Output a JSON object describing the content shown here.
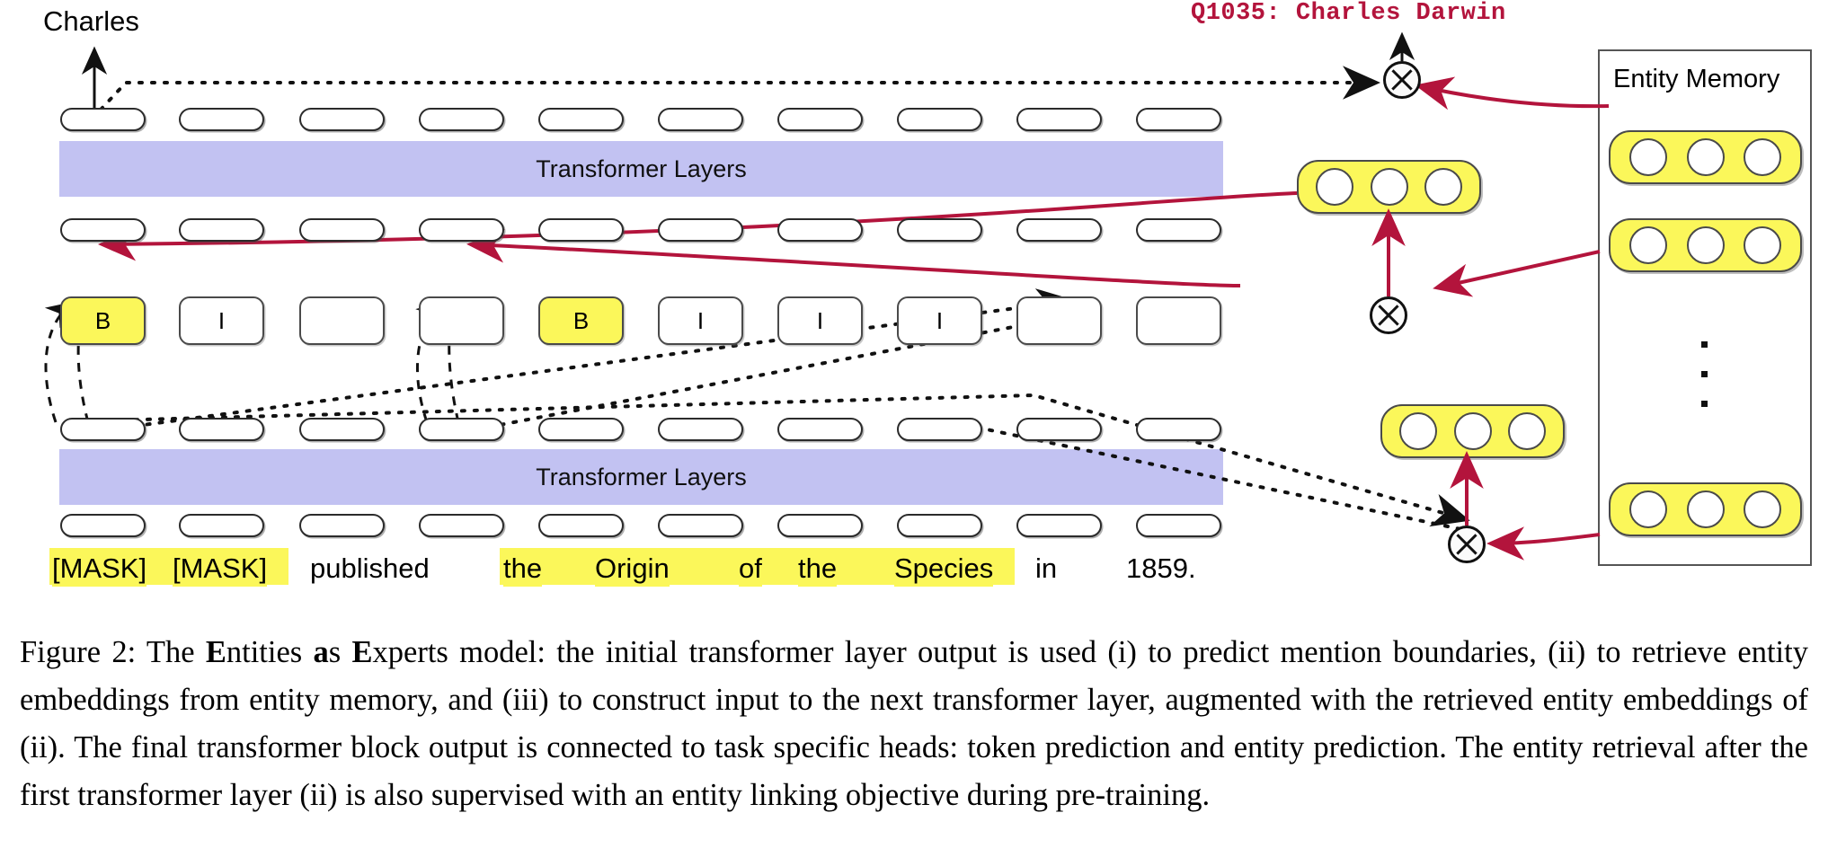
{
  "figure": {
    "output_token_label": "Charles",
    "entity_prediction_label": "Q1035: Charles Darwin",
    "transformer_bar_upper": "Transformer Layers",
    "transformer_bar_lower": "Transformer Layers",
    "entity_memory_title": "Entity Memory",
    "colors": {
      "transformer_bar": "#c2c2f2",
      "highlight_yellow": "#fbf75a",
      "entity_red": "#b3143c",
      "outline": "#2b2b2b",
      "background": "#ffffff"
    },
    "bio_tags": [
      "B",
      "I",
      "",
      "",
      "B",
      "I",
      "I",
      "I",
      "",
      ""
    ],
    "bio_highlighted": [
      true,
      false,
      false,
      false,
      true,
      false,
      false,
      false,
      false,
      false
    ],
    "sentence_tokens": [
      {
        "text": "[MASK]",
        "highlight": true
      },
      {
        "text": "[MASK]",
        "highlight": true
      },
      {
        "text": "published",
        "highlight": false
      },
      {
        "text": "the",
        "highlight": true
      },
      {
        "text": "Origin",
        "highlight": true
      },
      {
        "text": "of",
        "highlight": true
      },
      {
        "text": "the",
        "highlight": true
      },
      {
        "text": "Species",
        "highlight": true
      },
      {
        "text": "in",
        "highlight": false
      },
      {
        "text": "1859",
        "highlight": false
      },
      {
        "text": ".",
        "highlight": false
      }
    ],
    "token_row_count": 10,
    "operator_symbol": "⊗",
    "operator_count": 3,
    "memory_entries_visible": 3,
    "memory_ellipsis_dots": 3,
    "retrieved_embeddings": 2,
    "embedding_circles_per_pill": 3
  },
  "caption": {
    "prefix": "Figure 2: The ",
    "bold1": "E",
    "mid1": "ntities ",
    "bold2": "a",
    "mid2": "s ",
    "bold3": "E",
    "rest": "xperts model: the initial transformer layer output is used (i) to predict mention boundaries, (ii) to retrieve entity embeddings from entity memory, and (iii) to construct input to the next transformer layer, augmented with the retrieved entity embeddings of (ii). The final transformer block output is connected to task specific heads: token prediction and entity prediction. The entity retrieval after the first transformer layer (ii) is also supervised with an entity linking objective during pre-training."
  }
}
